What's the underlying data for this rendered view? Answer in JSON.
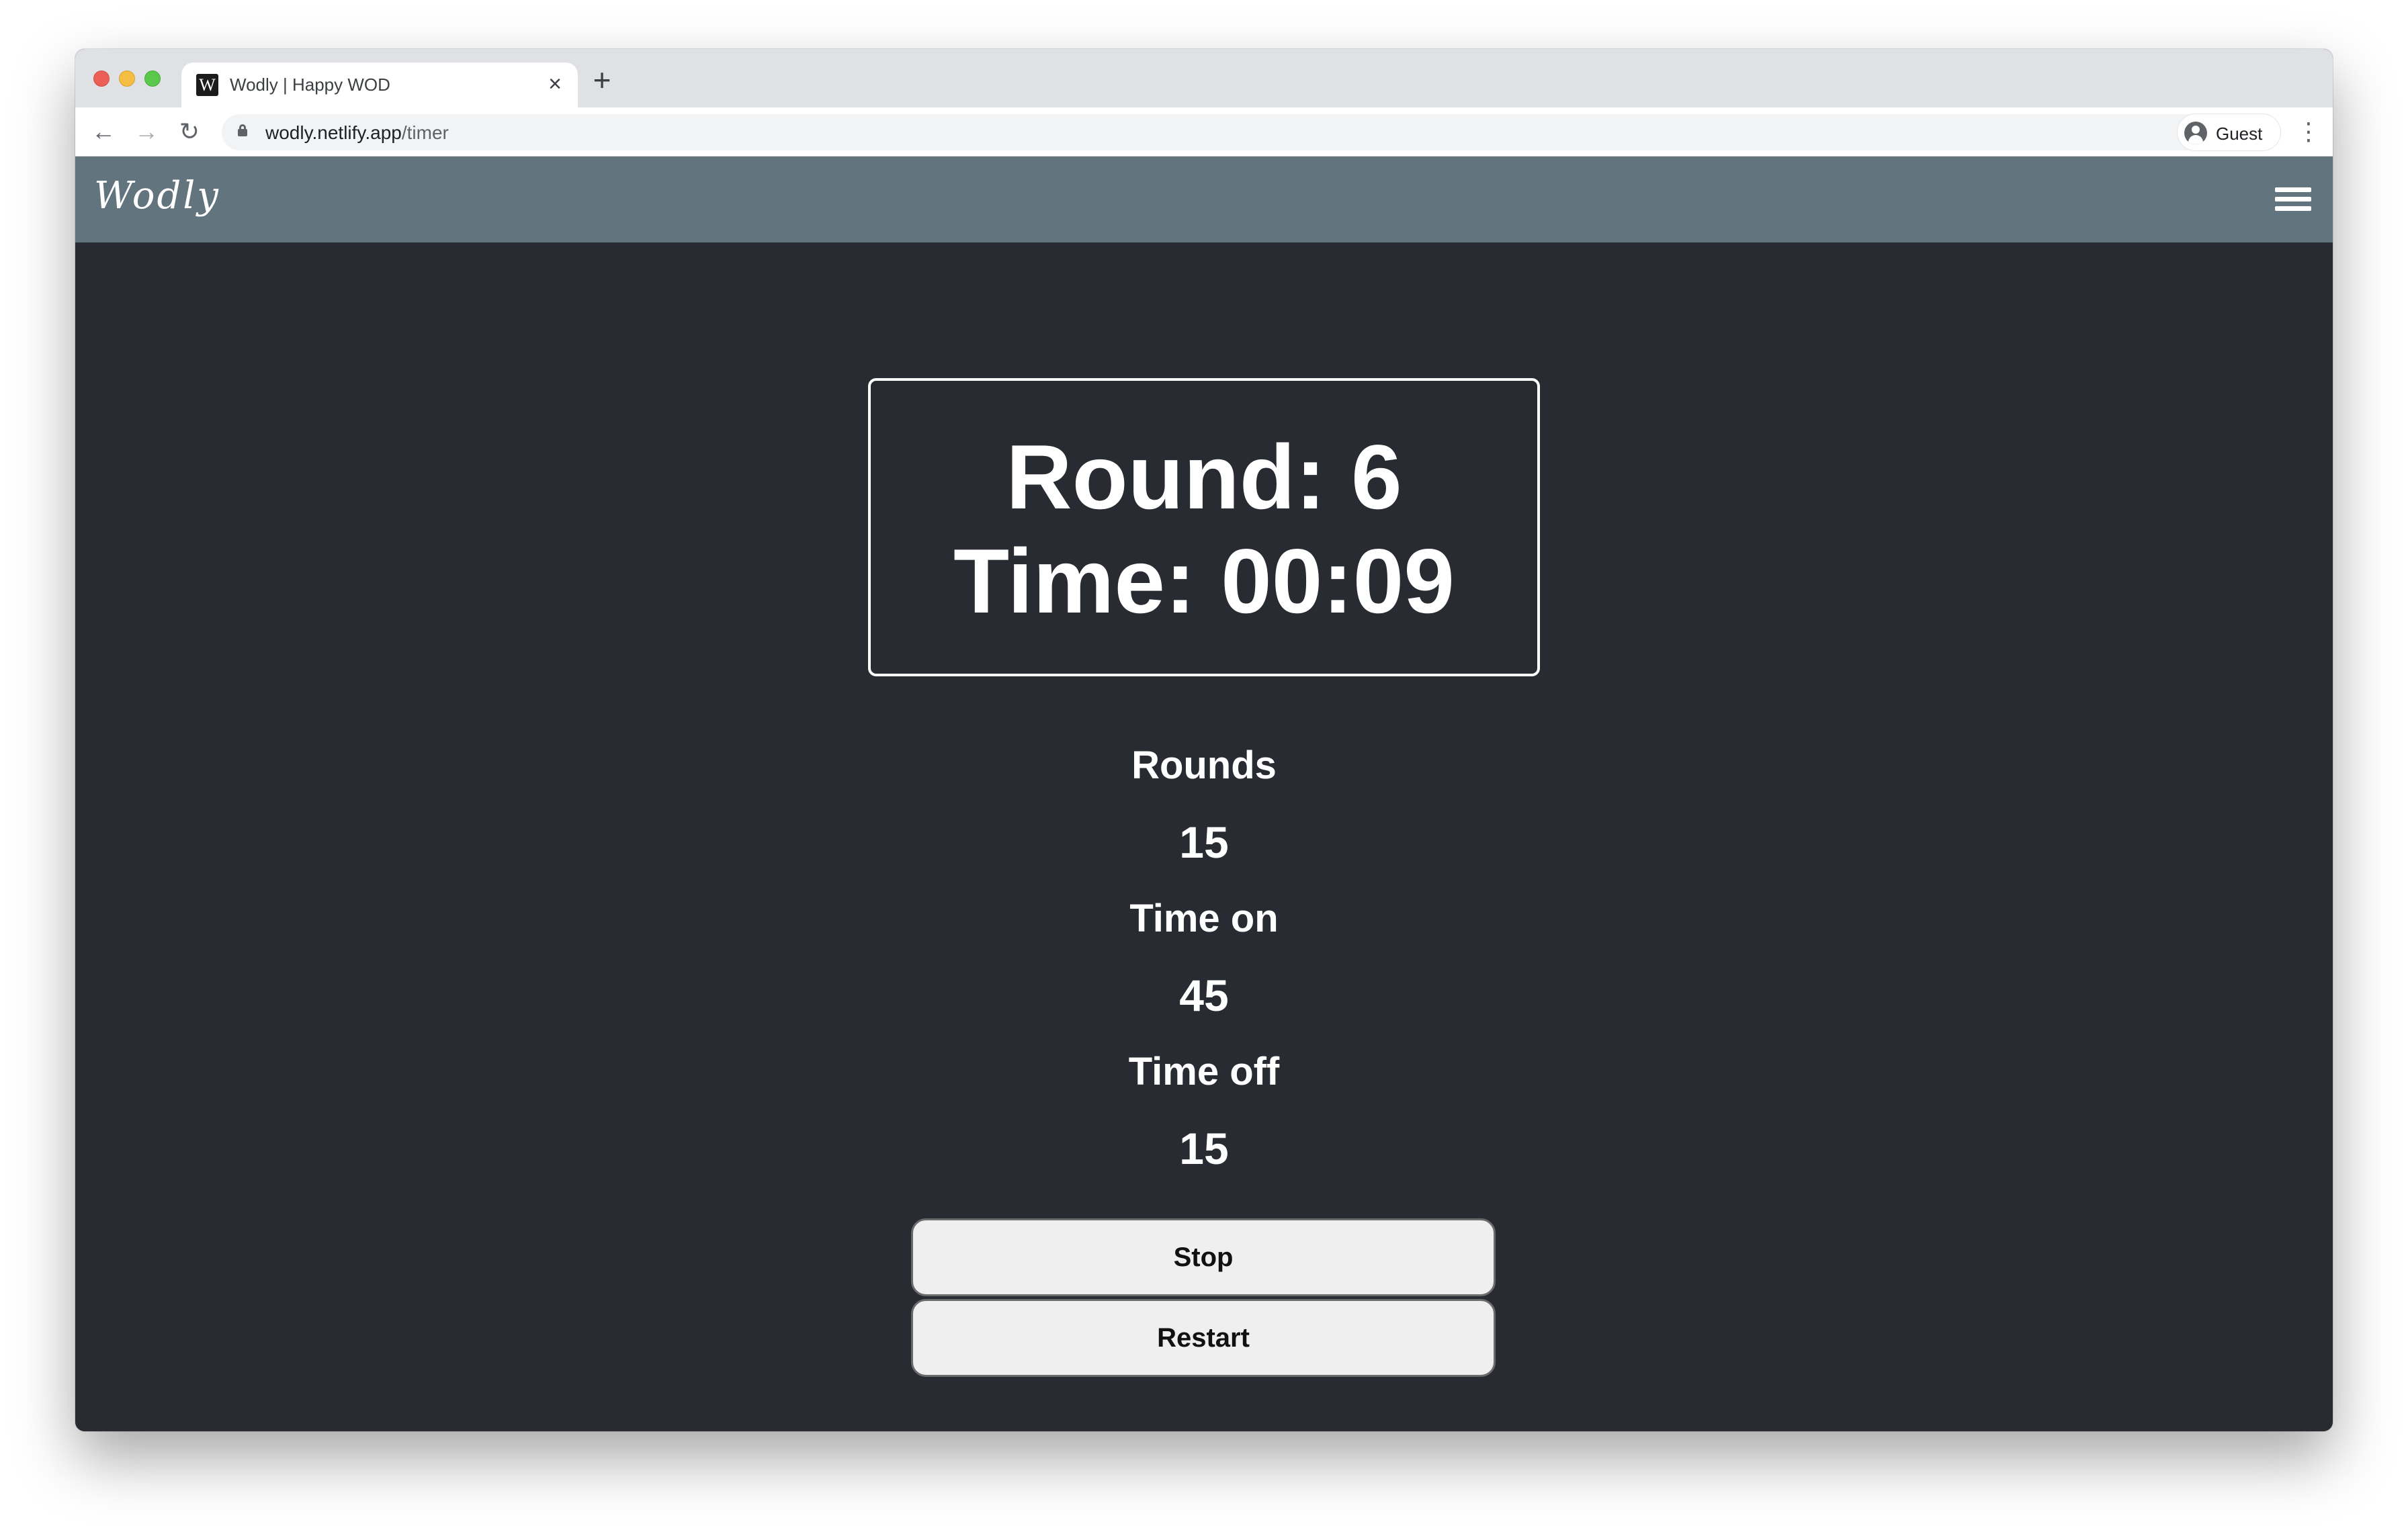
{
  "browser": {
    "tab": {
      "favicon_letter": "W",
      "title": "Wodly | Happy WOD",
      "close_symbol": "×"
    },
    "new_tab_symbol": "+",
    "nav": {
      "back_symbol": "←",
      "forward_symbol": "→",
      "reload_symbol": "↻"
    },
    "address": {
      "domain": "wodly.netlify.app",
      "path": "/timer"
    },
    "profile": {
      "label": "Guest"
    },
    "menu_symbol": "⋮"
  },
  "app": {
    "logo": "Wodly",
    "colors": {
      "header_bg": "#62747e",
      "page_bg": "#282b32",
      "button_bg": "#efefef"
    }
  },
  "timer": {
    "round_text": "Round: 6",
    "time_text": "Time: 00:09"
  },
  "settings": {
    "rounds_label": "Rounds",
    "rounds_value": "15",
    "time_on_label": "Time on",
    "time_on_value": "45",
    "time_off_label": "Time off",
    "time_off_value": "15"
  },
  "buttons": {
    "stop": "Stop",
    "restart": "Restart"
  }
}
